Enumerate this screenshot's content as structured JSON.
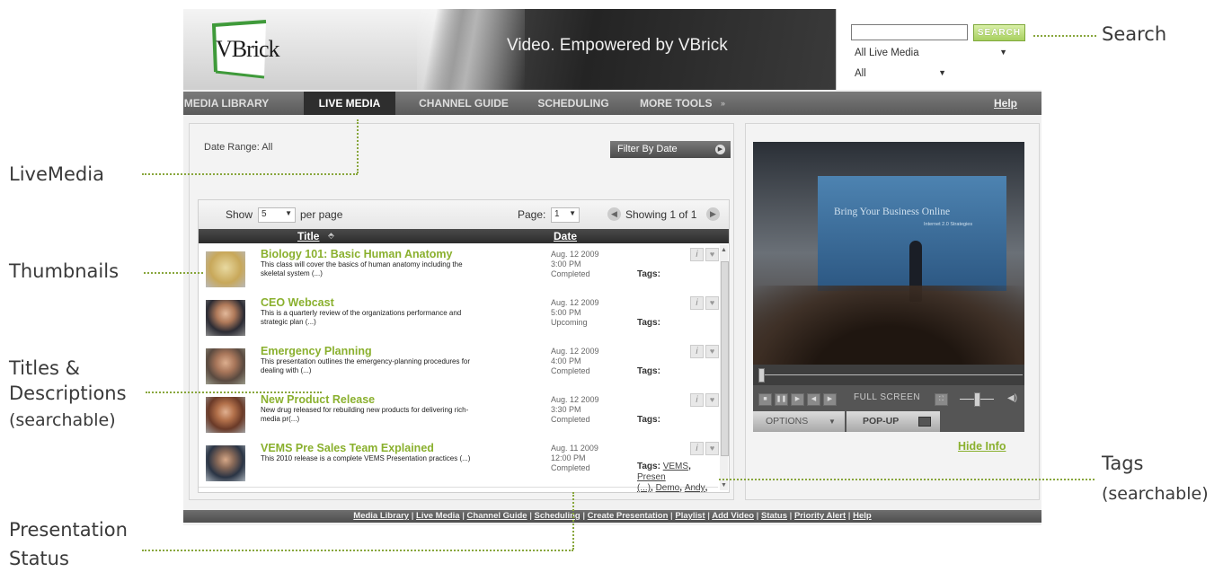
{
  "header": {
    "logo_text": "VBrick",
    "tagline": "Video. Empowered by VBrick",
    "search": {
      "value": "",
      "button": "SEARCH",
      "media_filter": "All Live Media",
      "category_filter": "All"
    }
  },
  "nav": {
    "items": [
      "MEDIA LIBRARY",
      "LIVE MEDIA",
      "CHANNEL GUIDE",
      "SCHEDULING",
      "MORE TOOLS"
    ],
    "more_indicator": "»",
    "help": "Help",
    "active": "LIVE MEDIA"
  },
  "list": {
    "date_range": "Date Range: All",
    "filter_button": "Filter By Date",
    "show_label": "Show",
    "show_value": "5",
    "per_page": "per page",
    "page_label": "Page:",
    "page_value": "1",
    "showing": "Showing 1 of 1",
    "col_title": "Title",
    "col_date": "Date",
    "rows": [
      {
        "title": "Biology 101: Basic Human Anatomy",
        "desc": "This class will cover the basics of human anatomy including the skeletal system (...)",
        "date": "Aug. 12 2009",
        "time": "3:00 PM",
        "status": "Completed",
        "tags_label": "Tags:",
        "tag_links": [],
        "thumb_color": "#d8c37a"
      },
      {
        "title": "CEO Webcast",
        "desc": "This is a quarterly review of the organizations performance and strategic plan (...)",
        "date": "Aug. 12 2009",
        "time": "5:00 PM",
        "status": "Upcoming",
        "tags_label": "Tags:",
        "tag_links": [],
        "thumb_color": "#6b4a3a"
      },
      {
        "title": "Emergency Planning",
        "desc": "This presentation outlines the emergency-planning procedures for dealing with (...)",
        "date": "Aug. 12 2009",
        "time": "4:00 PM",
        "status": "Completed",
        "tags_label": "Tags:",
        "tag_links": [],
        "thumb_color": "#7a5e45"
      },
      {
        "title": "New Product Release",
        "desc": "New drug released for rebuilding new products for delivering rich-media pr(...)",
        "date": "Aug. 12 2009",
        "time": "3:30 PM",
        "status": "Completed",
        "tags_label": "Tags:",
        "tag_links": [],
        "thumb_color": "#8a5a40"
      },
      {
        "title": "VEMS Pre Sales Team Explained",
        "desc": "This 2010 release is a complete VEMS Presentation practices (...)",
        "date": "Aug. 11 2009",
        "time": "12:00 PM",
        "status": "Completed",
        "tags_label": "Tags:",
        "tag_links": [
          "VEMS",
          "Presen",
          "(...)",
          "Demo",
          "Andy"
        ],
        "thumb_color": "#3a4a5a"
      }
    ]
  },
  "player": {
    "caption": "Bring Your Business Online",
    "subcaption": "Internet 2.0 Strategies",
    "fullscreen": "FULL SCREEN",
    "options": "OPTIONS",
    "popup": "POP-UP",
    "hide_info": "Hide Info"
  },
  "footer": {
    "links": [
      "Media Library",
      "Live Media",
      "Channel Guide",
      "Scheduling",
      "Create Presentation",
      "Playlist",
      "Add Video",
      "Status",
      "Priority Alert",
      "Help"
    ]
  },
  "callouts": {
    "search": "Search",
    "live_media": "LiveMedia",
    "thumbnails": "Thumbnails",
    "titles_line1": "Titles &",
    "titles_line2": "Descriptions",
    "titles_line3": "(searchable)",
    "tags_line1": "Tags",
    "tags_line2": "(searchable)",
    "status_line1": "Presentation",
    "status_line2": "Status"
  },
  "colors": {
    "accent_green": "#8ab02e",
    "logo_green": "#3f9a3a",
    "callout_dots": "#88a63c"
  }
}
